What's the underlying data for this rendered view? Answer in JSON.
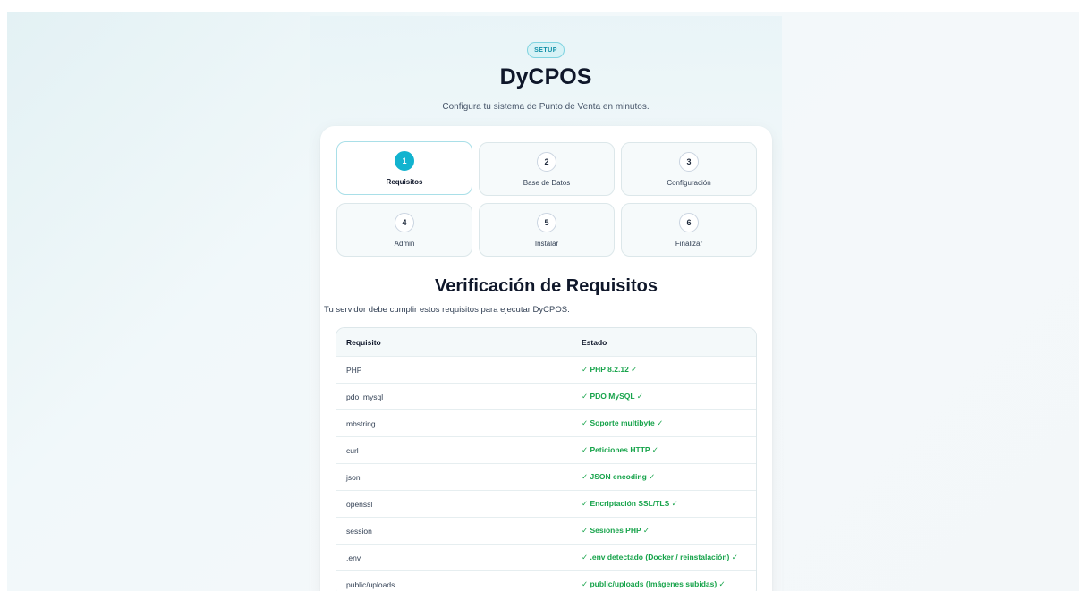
{
  "header": {
    "badge": "SETUP",
    "title": "DyCPOS",
    "subtitle": "Configura tu sistema de Punto de Venta en minutos."
  },
  "steps": [
    {
      "number": "1",
      "label": "Requisitos",
      "active": true
    },
    {
      "number": "2",
      "label": "Base de Datos",
      "active": false
    },
    {
      "number": "3",
      "label": "Configuración",
      "active": false
    },
    {
      "number": "4",
      "label": "Admin",
      "active": false
    },
    {
      "number": "5",
      "label": "Instalar",
      "active": false
    },
    {
      "number": "6",
      "label": "Finalizar",
      "active": false
    }
  ],
  "section": {
    "title": "Verificación de Requisitos",
    "description": "Tu servidor debe cumplir estos requisitos para ejecutar DyCPOS."
  },
  "table": {
    "headers": [
      "Requisito",
      "Estado"
    ],
    "rows": [
      {
        "name": "PHP",
        "status": "✓ PHP 8.2.12 ✓"
      },
      {
        "name": "pdo_mysql",
        "status": "✓ PDO MySQL ✓"
      },
      {
        "name": "mbstring",
        "status": "✓ Soporte multibyte ✓"
      },
      {
        "name": "curl",
        "status": "✓ Peticiones HTTP ✓"
      },
      {
        "name": "json",
        "status": "✓ JSON encoding ✓"
      },
      {
        "name": "openssl",
        "status": "✓ Encriptación SSL/TLS ✓"
      },
      {
        "name": "session",
        "status": "✓ Sesiones PHP ✓"
      },
      {
        "name": ".env",
        "status": "✓ .env detectado (Docker / reinstalación) ✓"
      },
      {
        "name": "public/uploads",
        "status": "✓ public/uploads (Imágenes subidas) ✓"
      }
    ]
  },
  "colors": {
    "accent": "#12b3cf",
    "success": "#16a34a",
    "badge_bg": "#d7f2f6"
  }
}
